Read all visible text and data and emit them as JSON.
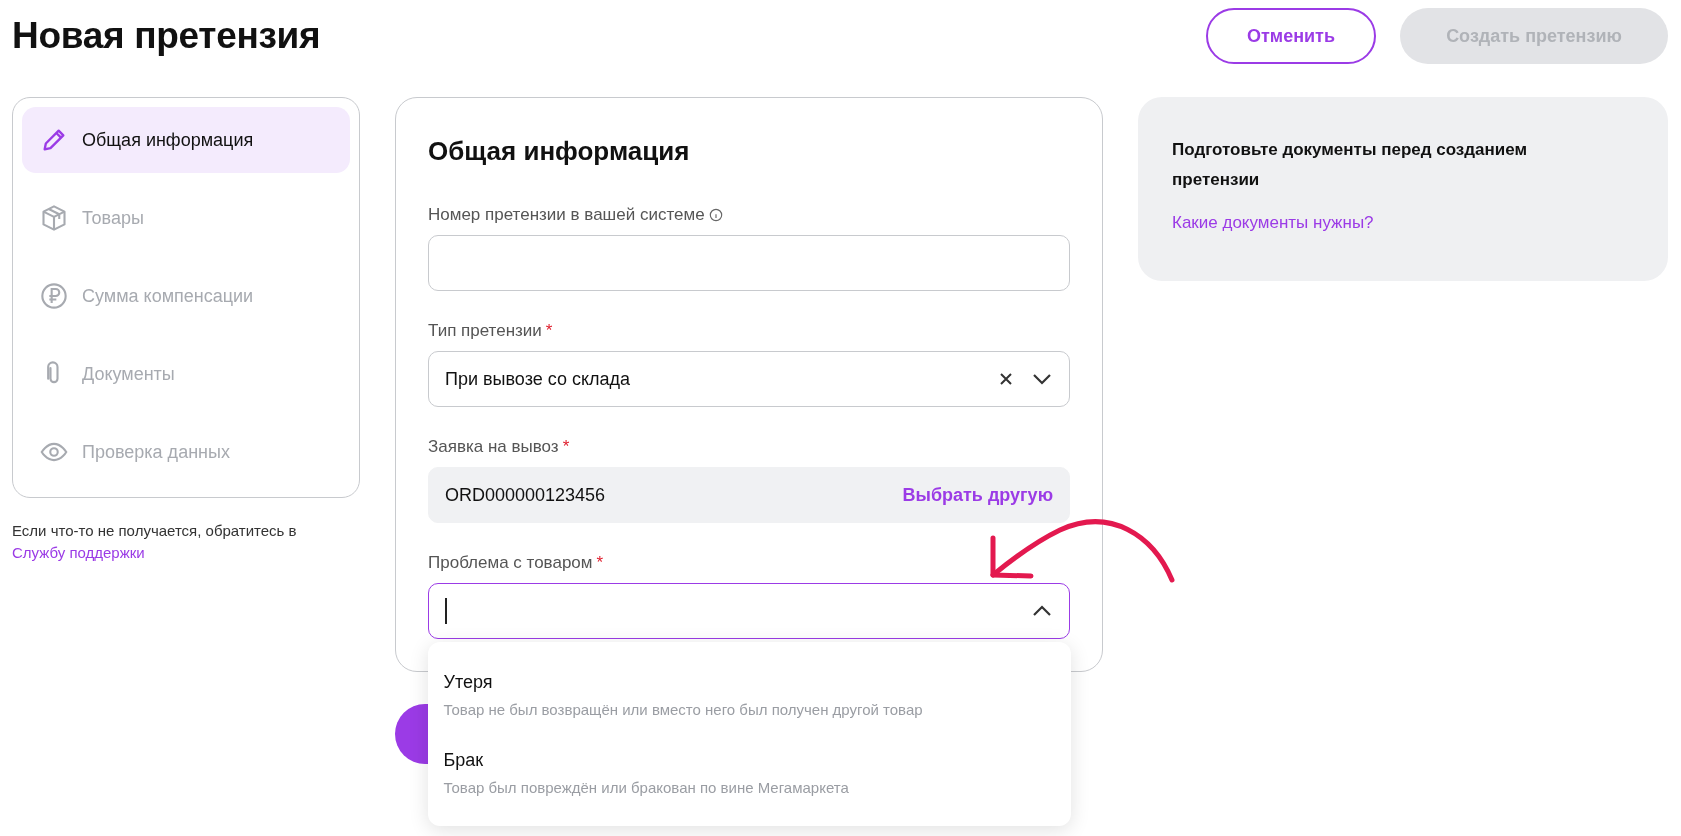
{
  "page": {
    "title": "Новая претензия"
  },
  "actions": [
    {
      "label": "Отменить",
      "kind": "outline",
      "disabled": false
    },
    {
      "label": "Создать претензию",
      "kind": "primary",
      "disabled": true
    }
  ],
  "steps": [
    {
      "label": "Общая информация",
      "selected": true
    },
    {
      "label": "Товары",
      "selected": false
    },
    {
      "label": "Сумма компенсации",
      "selected": false
    },
    {
      "label": "Документы",
      "selected": false
    },
    {
      "label": "Проверка данных",
      "selected": false
    }
  ],
  "help": {
    "text": "Если что-то не получается, обратитесь в",
    "link": "Службу поддержки"
  },
  "form": {
    "title": "Общая информация",
    "fields": [
      {
        "kind": "text",
        "label": "Номер претензии в вашей системе",
        "info": true
      },
      {
        "kind": "select",
        "label": "Тип претензии",
        "required_mark": "*",
        "value": "При вывозе со склада",
        "clearable": true,
        "expanded": false
      },
      {
        "kind": "picked",
        "label": "Заявка на вывоз",
        "required_mark": "*",
        "value": "ORD000000123456",
        "action": "Выбрать другую"
      },
      {
        "kind": "select",
        "label": "Проблема с товаром",
        "required_mark": "*",
        "focused": true,
        "expanded": true,
        "options": [
          {
            "title": "Утеря",
            "description": "Товар не был возвращён или вместо него был получен другой товар"
          },
          {
            "title": "Брак",
            "description": "Товар был повреждён или бракован по вине Мегамаркета"
          }
        ]
      }
    ]
  },
  "notice": {
    "text": "Подготовьте документы перед созданием претензии",
    "link": "Какие документы нужны?"
  }
}
